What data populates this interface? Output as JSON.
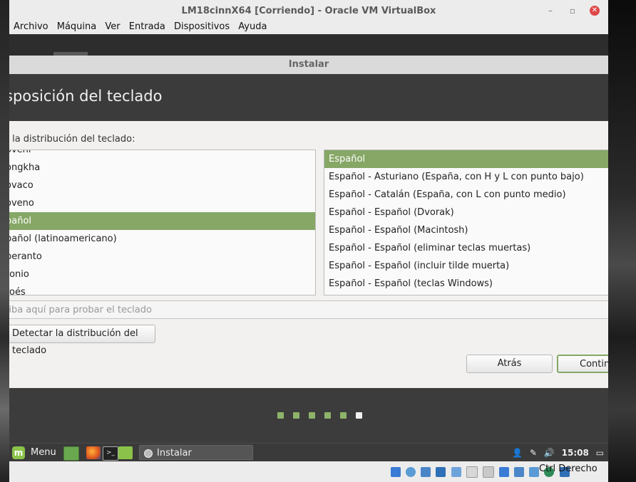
{
  "window": {
    "title": "LM18cinnX64 [Corriendo] - Oracle VM VirtualBox"
  },
  "menubar": [
    "Archivo",
    "Máquina",
    "Ver",
    "Entrada",
    "Dispositivos",
    "Ayuda"
  ],
  "installer": {
    "window_title": "Instalar",
    "heading": "sposición del teclado",
    "choose_label": "a la distribución del teclado:",
    "layouts": [
      "oveni",
      "ongkha",
      "ovaco",
      "oveno",
      "pañol",
      "pañol (latinoamericano)",
      "peranto",
      "tonio",
      "roés"
    ],
    "selected_layout_index": 4,
    "variants": [
      "Español",
      "Español - Asturiano (España, con H y L con punto bajo)",
      "Español - Catalán (España, con L con punto medio)",
      "Español - Español (Dvorak)",
      "Español - Español (Macintosh)",
      "Español - Español (eliminar teclas muertas)",
      "Español - Español (incluir tilde muerta)",
      "Español - Español (teclas Windows)"
    ],
    "selected_variant_index": 0,
    "test_placeholder": "riba aquí para probar el teclado",
    "detect_button": "Detectar la distribución del teclado",
    "back_button": "Atrás",
    "continue_button": "Continu",
    "progress": {
      "total_steps": 6,
      "current_step": 6
    }
  },
  "guest_taskbar": {
    "menu_label": "Menu",
    "task_label": "Instalar",
    "clock": "15:08"
  },
  "statusbar": {
    "host_key": "Ctrl Derecho"
  },
  "colors": {
    "accent": "#86a766",
    "header": "#3b3b3b"
  }
}
